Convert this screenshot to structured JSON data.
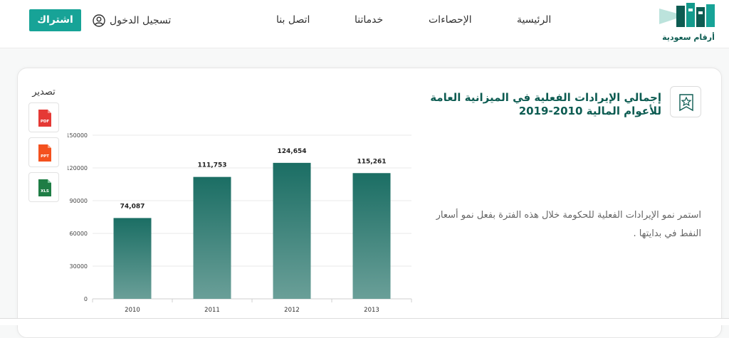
{
  "header": {
    "logo_text": "أرقام سعودية",
    "nav": [
      "الرئيسية",
      "الإحصاءات",
      "خدماتنا",
      "اتصل بنا"
    ],
    "login_label": "تسجيل الدخول",
    "subscribe_label": "اشتراك"
  },
  "card": {
    "title": "إجمالي الإيرادات الفعلية في الميزانية العامة للأعوام المالية 2010-2019",
    "description": "استمر نمو الإيرادات الفعلية للحكومة خلال هذه الفترة بفعل نمو أسعار النفط في بدايتها .",
    "export_label": "تصدير",
    "export_buttons": [
      "PDF",
      "PPT",
      "XLS"
    ]
  },
  "colors": {
    "accent": "#17a397",
    "bar_top": "#1b6e64",
    "bar_bottom": "#6a9f98",
    "pdf": "#e53935",
    "ppt": "#f4511e",
    "xls": "#1e7d45"
  },
  "chart_data": {
    "type": "bar",
    "categories": [
      "2010",
      "2011",
      "2012",
      "2013"
    ],
    "values": [
      74087,
      111753,
      124654,
      115261
    ],
    "data_labels": [
      "74,087",
      "111,753",
      "124,654",
      "115,261"
    ],
    "yticks": [
      "0",
      "30000",
      "60000",
      "90000",
      "120000",
      "150000"
    ],
    "ylim": [
      0,
      150000
    ],
    "grid": true,
    "title": "",
    "xlabel": "",
    "ylabel": ""
  }
}
